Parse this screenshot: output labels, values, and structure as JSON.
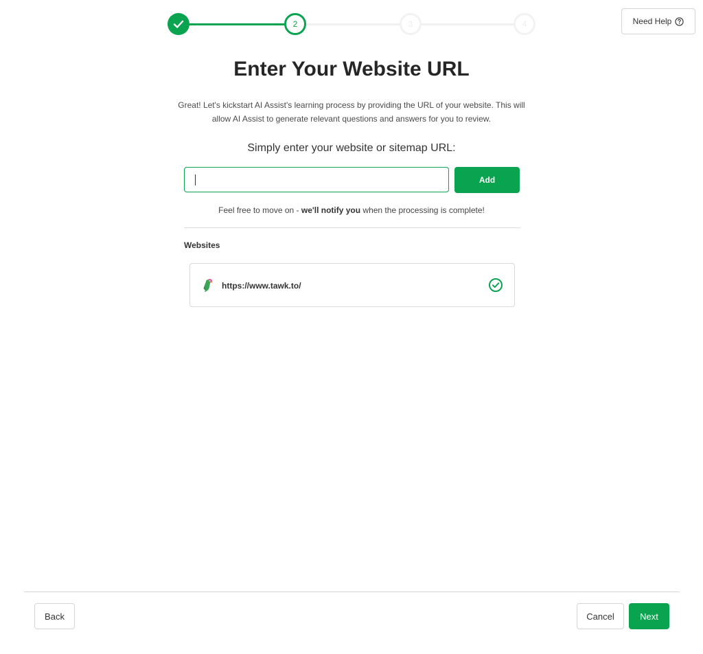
{
  "stepper": {
    "steps": [
      {
        "label": "",
        "state": "complete"
      },
      {
        "label": "2",
        "state": "active"
      },
      {
        "label": "3",
        "state": "pending"
      },
      {
        "label": "4",
        "state": "pending"
      }
    ]
  },
  "help_button": {
    "label": "Need Help",
    "icon": "question-circle-icon"
  },
  "title": "Enter Your Website URL",
  "description": "Great! Let's kickstart AI Assist's learning process by providing the URL of your website. This will allow AI Assist to generate relevant questions and answers for you to review.",
  "subtitle": "Simply enter your website or sitemap URL:",
  "url_input": {
    "value": "",
    "placeholder": ""
  },
  "add_button": "Add",
  "notify": {
    "prefix": "Feel free to move on - ",
    "bold": "we'll notify you",
    "suffix": " when the processing is complete!"
  },
  "websites_section": {
    "label": "Websites",
    "items": [
      {
        "url": "https://www.tawk.to/",
        "status": "complete",
        "icon": "tawk-parrot-icon"
      }
    ]
  },
  "footer": {
    "back": "Back",
    "cancel": "Cancel",
    "next": "Next"
  },
  "colors": {
    "accent": "#0aa34f",
    "border": "#d4d4d4",
    "text": "#333333"
  }
}
